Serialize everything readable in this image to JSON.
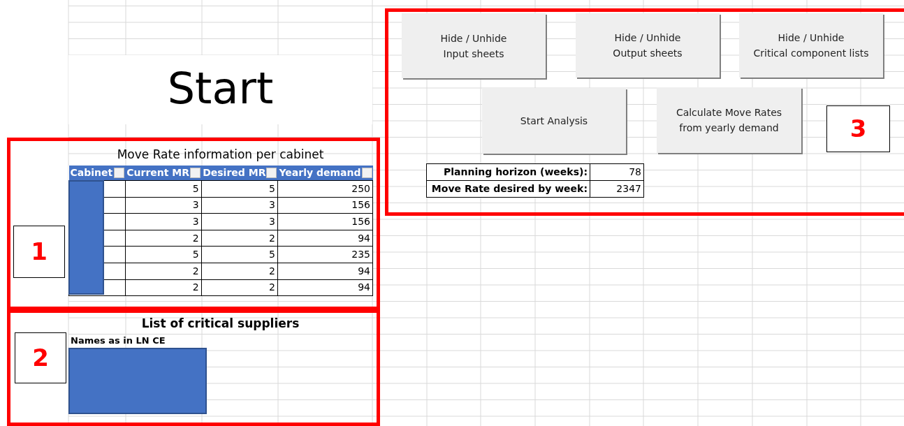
{
  "title": "Start",
  "cabinet_table": {
    "title": "Move Rate information per cabinet",
    "columns": [
      "Cabinet",
      "Current MR",
      "Desired MR",
      "Yearly demand"
    ],
    "rows": [
      [
        "",
        "5",
        "5",
        "250"
      ],
      [
        "",
        "3",
        "3",
        "156"
      ],
      [
        "",
        "3",
        "3",
        "156"
      ],
      [
        "",
        "2",
        "2",
        "94"
      ],
      [
        "",
        "5",
        "5",
        "235"
      ],
      [
        "",
        "2",
        "2",
        "94"
      ],
      [
        "",
        "2",
        "2",
        "94"
      ]
    ]
  },
  "suppliers": {
    "title": "List of critical suppliers",
    "column": "Names as in LN CE"
  },
  "buttons": [
    {
      "lines": [
        "Hide / Unhide",
        "Input sheets"
      ]
    },
    {
      "lines": [
        "Hide / Unhide",
        "Output sheets"
      ]
    },
    {
      "lines": [
        "Hide / Unhide",
        "Critical component lists"
      ]
    },
    {
      "lines": [
        "Start Analysis"
      ]
    },
    {
      "lines": [
        "Calculate Move Rates",
        "from yearly demand"
      ]
    }
  ],
  "planning": [
    {
      "label": "Planning horizon (weeks):",
      "value": "78"
    },
    {
      "label": "Move Rate desired by week:",
      "value": "2347"
    }
  ],
  "annotations": [
    {
      "label": "1"
    },
    {
      "label": "2"
    },
    {
      "label": "3"
    }
  ]
}
